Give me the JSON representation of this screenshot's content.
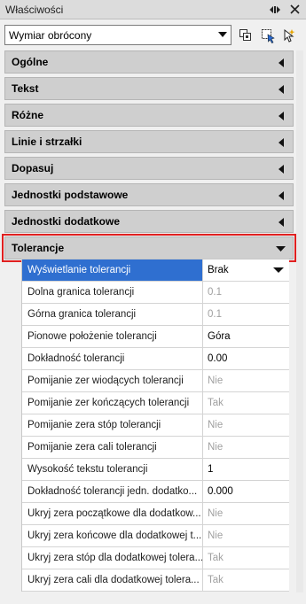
{
  "panel": {
    "title": "Właściwości"
  },
  "selector": {
    "value": "Wymiar obrócony"
  },
  "sections": [
    {
      "label": "Ogólne"
    },
    {
      "label": "Tekst"
    },
    {
      "label": "Różne"
    },
    {
      "label": "Linie i strzałki"
    },
    {
      "label": "Dopasuj"
    },
    {
      "label": "Jednostki podstawowe"
    },
    {
      "label": "Jednostki dodatkowe"
    },
    {
      "label": "Tolerancje"
    }
  ],
  "properties": [
    {
      "name": "Wyświetlanie tolerancji",
      "value": "Brak"
    },
    {
      "name": "Dolna granica tolerancji",
      "value": "0.1"
    },
    {
      "name": "Górna granica tolerancji",
      "value": "0.1"
    },
    {
      "name": "Pionowe położenie tolerancji",
      "value": "Góra"
    },
    {
      "name": "Dokładność tolerancji",
      "value": "0.00"
    },
    {
      "name": "Pomijanie zer wiodących tolerancji",
      "value": "Nie"
    },
    {
      "name": "Pomijanie zer kończących tolerancji",
      "value": "Tak"
    },
    {
      "name": "Pomijanie zera stóp tolerancji",
      "value": "Nie"
    },
    {
      "name": "Pomijanie zera cali tolerancji",
      "value": "Nie"
    },
    {
      "name": "Wysokość tekstu tolerancji",
      "value": "1"
    },
    {
      "name": "Dokładność tolerancji jedn. dodatko...",
      "value": "0.000"
    },
    {
      "name": "Ukryj zera początkowe dla dodatkow...",
      "value": "Nie"
    },
    {
      "name": "Ukryj zera końcowe dla dodatkowej t...",
      "value": "Nie"
    },
    {
      "name": "Ukryj zera stóp dla dodatkowej tolera...",
      "value": "Tak"
    },
    {
      "name": "Ukryj zera cali dla dodatkowej tolera...",
      "value": "Tak"
    }
  ],
  "colors": {
    "highlight": "#e02020",
    "selection": "#2f6fd0"
  }
}
